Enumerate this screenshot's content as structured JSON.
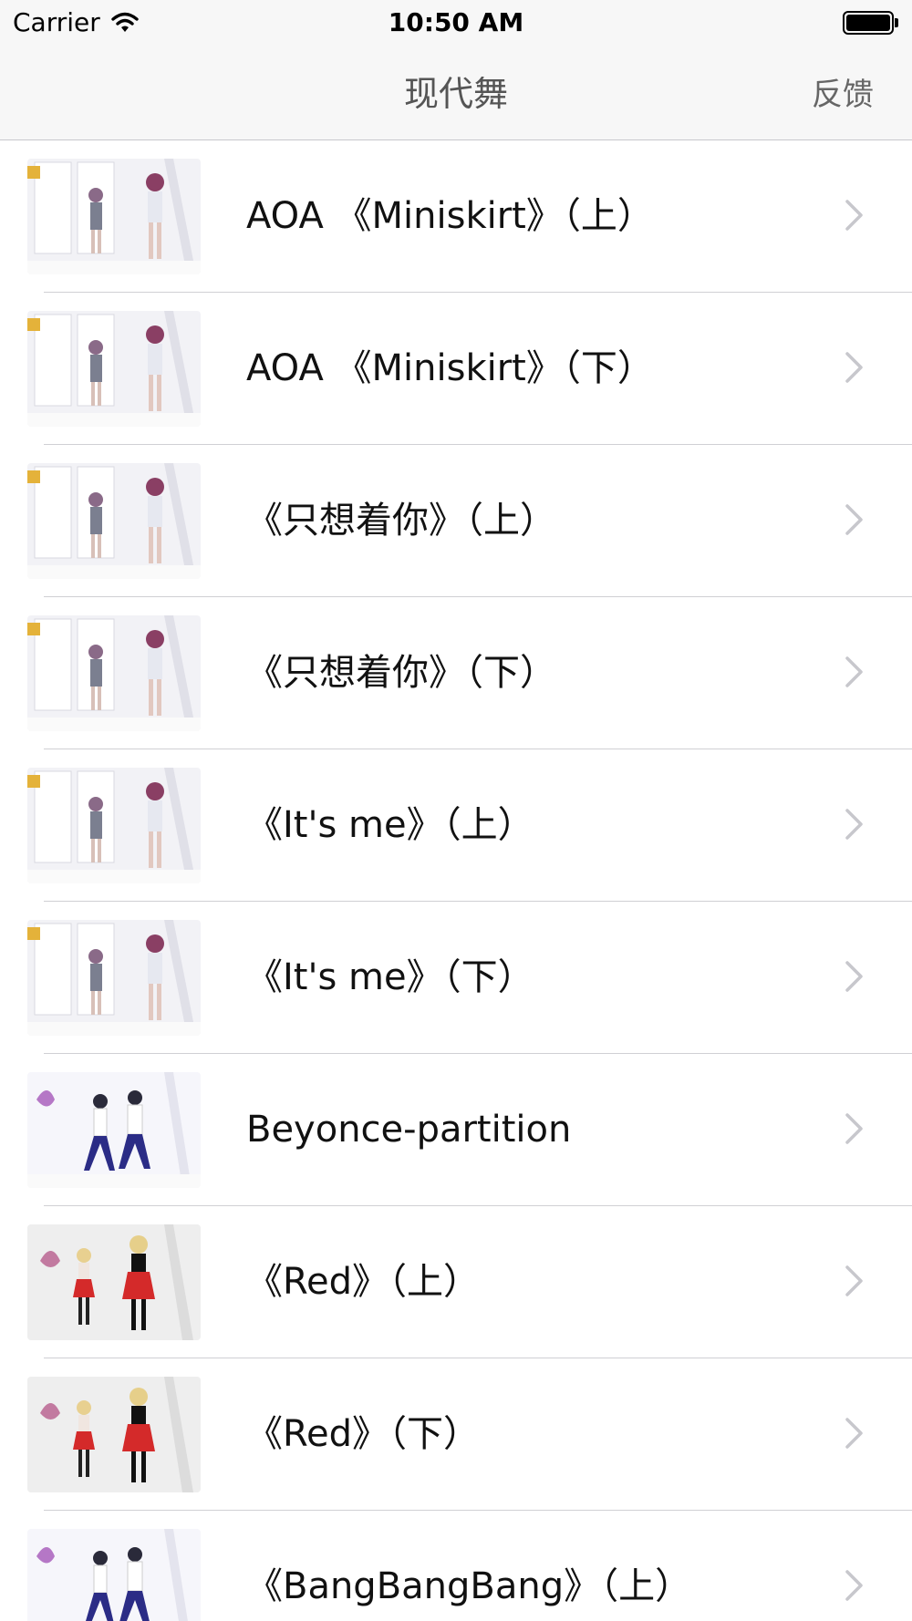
{
  "status_bar": {
    "carrier": "Carrier",
    "time": "10:50 AM"
  },
  "nav": {
    "title": "现代舞",
    "feedback": "反馈"
  },
  "list": {
    "items": [
      {
        "label": "AOA 《Miniskirt》（上）",
        "thumb": "stage"
      },
      {
        "label": "AOA 《Miniskirt》（下）",
        "thumb": "stage"
      },
      {
        "label": "《只想着你》（上）",
        "thumb": "stage"
      },
      {
        "label": "《只想着你》（下）",
        "thumb": "stage"
      },
      {
        "label": "《It's me》（上）",
        "thumb": "stage"
      },
      {
        "label": "《It's me》（下）",
        "thumb": "stage"
      },
      {
        "label": "Beyonce-partition",
        "thumb": "studio"
      },
      {
        "label": "《Red》（上）",
        "thumb": "red"
      },
      {
        "label": "《Red》（下）",
        "thumb": "red"
      },
      {
        "label": "《BangBangBang》（上）",
        "thumb": "studio"
      }
    ]
  },
  "colors": {
    "bar_background": "#f7f7f7",
    "separator": "#d0d0d4",
    "chevron": "#c7c7cc",
    "title_text": "#555555"
  }
}
